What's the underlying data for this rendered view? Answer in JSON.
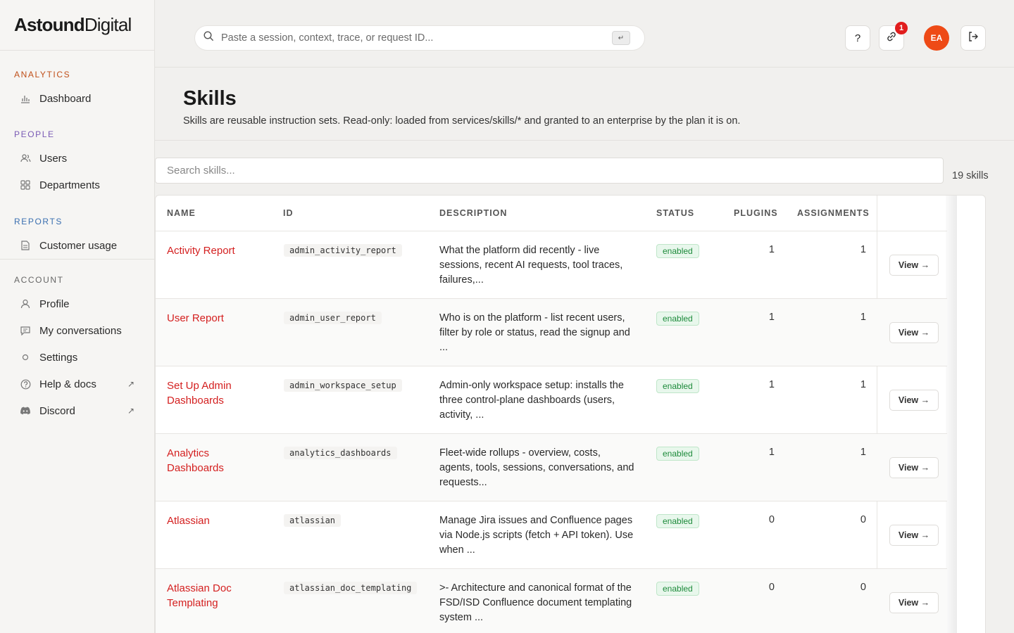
{
  "brand": {
    "part1": "Astound",
    "part2": "Digital"
  },
  "sidebar": {
    "sections": [
      {
        "label": "ANALYTICS",
        "color": "#c0501a",
        "items": [
          {
            "label": "Dashboard",
            "icon": "bar-chart-icon"
          }
        ]
      },
      {
        "label": "PEOPLE",
        "color": "#7a5bb5",
        "items": [
          {
            "label": "Users",
            "icon": "users-icon"
          },
          {
            "label": "Departments",
            "icon": "grid-icon"
          }
        ]
      },
      {
        "label": "REPORTS",
        "color": "#3a6fb0",
        "items": [
          {
            "label": "Customer usage",
            "icon": "document-icon"
          }
        ]
      },
      {
        "label": "ACCOUNT",
        "color": "#666666",
        "items": [
          {
            "label": "Profile",
            "icon": "person-icon"
          },
          {
            "label": "My conversations",
            "icon": "chat-icon"
          },
          {
            "label": "Settings",
            "icon": "circle-icon"
          },
          {
            "label": "Help & docs",
            "icon": "help-icon",
            "external": "↗"
          },
          {
            "label": "Discord",
            "icon": "discord-icon",
            "external": "↗"
          }
        ]
      }
    ]
  },
  "topbar": {
    "search_placeholder": "Paste a session, context, trace, or request ID...",
    "kbd": "↵",
    "help_label": "?",
    "notification_count": "1",
    "avatar_initials": "EA"
  },
  "page": {
    "title": "Skills",
    "subtitle": "Skills are reusable instruction sets. Read-only: loaded from services/skills/* and granted to an enterprise by the plan it is on.",
    "search_placeholder": "Search skills...",
    "count_label": "19 skills"
  },
  "table": {
    "headers": {
      "name": "NAME",
      "id": "ID",
      "description": "DESCRIPTION",
      "status": "STATUS",
      "plugins": "PLUGINS",
      "assignments": "ASSIGNMENTS"
    },
    "view_label": "View →",
    "rows": [
      {
        "name": "Activity Report",
        "id": "admin_activity_report",
        "description": "What the platform did recently - live sessions, recent AI requests, tool traces, failures,...",
        "status": "enabled",
        "plugins": "1",
        "assignments": "1"
      },
      {
        "name": "User Report",
        "id": "admin_user_report",
        "description": "Who is on the platform - list recent users, filter by role or status, read the signup and ...",
        "status": "enabled",
        "plugins": "1",
        "assignments": "1"
      },
      {
        "name": "Set Up Admin Dashboards",
        "id": "admin_workspace_setup",
        "description": "Admin-only workspace setup: installs the three control-plane dashboards (users, activity, ...",
        "status": "enabled",
        "plugins": "1",
        "assignments": "1"
      },
      {
        "name": "Analytics Dashboards",
        "id": "analytics_dashboards",
        "description": "Fleet-wide rollups - overview, costs, agents, tools, sessions, conversations, and requests...",
        "status": "enabled",
        "plugins": "1",
        "assignments": "1"
      },
      {
        "name": "Atlassian",
        "id": "atlassian",
        "description": "Manage Jira issues and Confluence pages via Node.js scripts (fetch + API token). Use when ...",
        "status": "enabled",
        "plugins": "0",
        "assignments": "0"
      },
      {
        "name": "Atlassian Doc Templating",
        "id": "atlassian_doc_templating",
        "description": ">- Architecture and canonical format of the FSD/ISD Confluence document templating system ...",
        "status": "enabled",
        "plugins": "0",
        "assignments": "0"
      }
    ]
  }
}
